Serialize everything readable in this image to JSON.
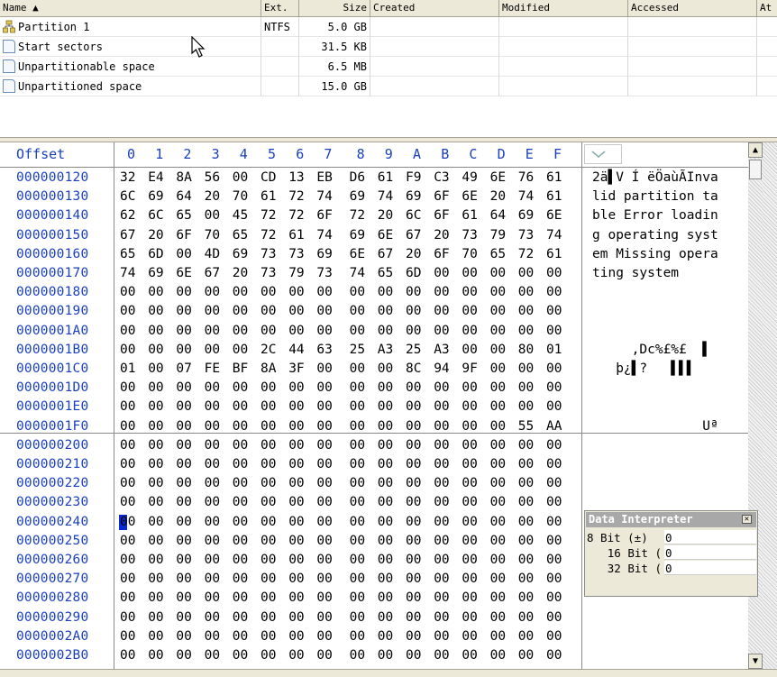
{
  "file_list": {
    "columns": [
      "Name ▲",
      "Ext.",
      "Size",
      "Created",
      "Modified",
      "Accessed",
      "At"
    ],
    "rows": [
      {
        "name": "Partition 1",
        "ext": "NTFS",
        "size": "5.0 GB",
        "icon": "partition-icon"
      },
      {
        "name": "Start sectors",
        "ext": "",
        "size": "31.5 KB",
        "icon": "document-icon"
      },
      {
        "name": "Unpartitionable space",
        "ext": "",
        "size": "6.5 MB",
        "icon": "document-icon"
      },
      {
        "name": "Unpartitioned space",
        "ext": "",
        "size": "15.0 GB",
        "icon": "document-icon"
      }
    ]
  },
  "hex": {
    "offset_header": "Offset",
    "column_headers": [
      "0",
      "1",
      "2",
      "3",
      "4",
      "5",
      "6",
      "7",
      "8",
      "9",
      "A",
      "B",
      "C",
      "D",
      "E",
      "F"
    ],
    "rows": [
      {
        "offset": "000000120",
        "bytes": [
          "32",
          "E4",
          "8A",
          "56",
          "00",
          "CD",
          "13",
          "EB",
          "D6",
          "61",
          "F9",
          "C3",
          "49",
          "6E",
          "76",
          "61"
        ],
        "ascii": "2ä▌V Í ëÖaùÃInva"
      },
      {
        "offset": "000000130",
        "bytes": [
          "6C",
          "69",
          "64",
          "20",
          "70",
          "61",
          "72",
          "74",
          "69",
          "74",
          "69",
          "6F",
          "6E",
          "20",
          "74",
          "61"
        ],
        "ascii": "lid partition ta"
      },
      {
        "offset": "000000140",
        "bytes": [
          "62",
          "6C",
          "65",
          "00",
          "45",
          "72",
          "72",
          "6F",
          "72",
          "20",
          "6C",
          "6F",
          "61",
          "64",
          "69",
          "6E"
        ],
        "ascii": "ble Error loadin"
      },
      {
        "offset": "000000150",
        "bytes": [
          "67",
          "20",
          "6F",
          "70",
          "65",
          "72",
          "61",
          "74",
          "69",
          "6E",
          "67",
          "20",
          "73",
          "79",
          "73",
          "74"
        ],
        "ascii": "g operating syst"
      },
      {
        "offset": "000000160",
        "bytes": [
          "65",
          "6D",
          "00",
          "4D",
          "69",
          "73",
          "73",
          "69",
          "6E",
          "67",
          "20",
          "6F",
          "70",
          "65",
          "72",
          "61"
        ],
        "ascii": "em Missing opera"
      },
      {
        "offset": "000000170",
        "bytes": [
          "74",
          "69",
          "6E",
          "67",
          "20",
          "73",
          "79",
          "73",
          "74",
          "65",
          "6D",
          "00",
          "00",
          "00",
          "00",
          "00"
        ],
        "ascii": "ting system"
      },
      {
        "offset": "000000180",
        "bytes": [
          "00",
          "00",
          "00",
          "00",
          "00",
          "00",
          "00",
          "00",
          "00",
          "00",
          "00",
          "00",
          "00",
          "00",
          "00",
          "00"
        ],
        "ascii": ""
      },
      {
        "offset": "000000190",
        "bytes": [
          "00",
          "00",
          "00",
          "00",
          "00",
          "00",
          "00",
          "00",
          "00",
          "00",
          "00",
          "00",
          "00",
          "00",
          "00",
          "00"
        ],
        "ascii": ""
      },
      {
        "offset": "0000001A0",
        "bytes": [
          "00",
          "00",
          "00",
          "00",
          "00",
          "00",
          "00",
          "00",
          "00",
          "00",
          "00",
          "00",
          "00",
          "00",
          "00",
          "00"
        ],
        "ascii": ""
      },
      {
        "offset": "0000001B0",
        "bytes": [
          "00",
          "00",
          "00",
          "00",
          "00",
          "2C",
          "44",
          "63",
          "25",
          "A3",
          "25",
          "A3",
          "00",
          "00",
          "80",
          "01"
        ],
        "ascii": "     ,Dc%£%£  ▌"
      },
      {
        "offset": "0000001C0",
        "bytes": [
          "01",
          "00",
          "07",
          "FE",
          "BF",
          "8A",
          "3F",
          "00",
          "00",
          "00",
          "8C",
          "94",
          "9F",
          "00",
          "00",
          "00"
        ],
        "ascii": "   þ¿▌?   ▌▌▌"
      },
      {
        "offset": "0000001D0",
        "bytes": [
          "00",
          "00",
          "00",
          "00",
          "00",
          "00",
          "00",
          "00",
          "00",
          "00",
          "00",
          "00",
          "00",
          "00",
          "00",
          "00"
        ],
        "ascii": ""
      },
      {
        "offset": "0000001E0",
        "bytes": [
          "00",
          "00",
          "00",
          "00",
          "00",
          "00",
          "00",
          "00",
          "00",
          "00",
          "00",
          "00",
          "00",
          "00",
          "00",
          "00"
        ],
        "ascii": ""
      },
      {
        "offset": "0000001F0",
        "bytes": [
          "00",
          "00",
          "00",
          "00",
          "00",
          "00",
          "00",
          "00",
          "00",
          "00",
          "00",
          "00",
          "00",
          "00",
          "55",
          "AA"
        ],
        "ascii": "              Uª"
      },
      {
        "offset": "000000200",
        "bytes": [
          "00",
          "00",
          "00",
          "00",
          "00",
          "00",
          "00",
          "00",
          "00",
          "00",
          "00",
          "00",
          "00",
          "00",
          "00",
          "00"
        ],
        "ascii": ""
      },
      {
        "offset": "000000210",
        "bytes": [
          "00",
          "00",
          "00",
          "00",
          "00",
          "00",
          "00",
          "00",
          "00",
          "00",
          "00",
          "00",
          "00",
          "00",
          "00",
          "00"
        ],
        "ascii": ""
      },
      {
        "offset": "000000220",
        "bytes": [
          "00",
          "00",
          "00",
          "00",
          "00",
          "00",
          "00",
          "00",
          "00",
          "00",
          "00",
          "00",
          "00",
          "00",
          "00",
          "00"
        ],
        "ascii": ""
      },
      {
        "offset": "000000230",
        "bytes": [
          "00",
          "00",
          "00",
          "00",
          "00",
          "00",
          "00",
          "00",
          "00",
          "00",
          "00",
          "00",
          "00",
          "00",
          "00",
          "00"
        ],
        "ascii": ""
      },
      {
        "offset": "000000240",
        "bytes": [
          "00",
          "00",
          "00",
          "00",
          "00",
          "00",
          "00",
          "00",
          "00",
          "00",
          "00",
          "00",
          "00",
          "00",
          "00",
          "00"
        ],
        "ascii": ""
      },
      {
        "offset": "000000250",
        "bytes": [
          "00",
          "00",
          "00",
          "00",
          "00",
          "00",
          "00",
          "00",
          "00",
          "00",
          "00",
          "00",
          "00",
          "00",
          "00",
          "00"
        ],
        "ascii": ""
      },
      {
        "offset": "000000260",
        "bytes": [
          "00",
          "00",
          "00",
          "00",
          "00",
          "00",
          "00",
          "00",
          "00",
          "00",
          "00",
          "00",
          "00",
          "00",
          "00",
          "00"
        ],
        "ascii": ""
      },
      {
        "offset": "000000270",
        "bytes": [
          "00",
          "00",
          "00",
          "00",
          "00",
          "00",
          "00",
          "00",
          "00",
          "00",
          "00",
          "00",
          "00",
          "00",
          "00",
          "00"
        ],
        "ascii": ""
      },
      {
        "offset": "000000280",
        "bytes": [
          "00",
          "00",
          "00",
          "00",
          "00",
          "00",
          "00",
          "00",
          "00",
          "00",
          "00",
          "00",
          "00",
          "00",
          "00",
          "00"
        ],
        "ascii": ""
      },
      {
        "offset": "000000290",
        "bytes": [
          "00",
          "00",
          "00",
          "00",
          "00",
          "00",
          "00",
          "00",
          "00",
          "00",
          "00",
          "00",
          "00",
          "00",
          "00",
          "00"
        ],
        "ascii": ""
      },
      {
        "offset": "0000002A0",
        "bytes": [
          "00",
          "00",
          "00",
          "00",
          "00",
          "00",
          "00",
          "00",
          "00",
          "00",
          "00",
          "00",
          "00",
          "00",
          "00",
          "00"
        ],
        "ascii": ""
      },
      {
        "offset": "0000002B0",
        "bytes": [
          "00",
          "00",
          "00",
          "00",
          "00",
          "00",
          "00",
          "00",
          "00",
          "00",
          "00",
          "00",
          "00",
          "00",
          "00",
          "00"
        ],
        "ascii": ""
      }
    ],
    "cursor": {
      "row": 18,
      "col": 0
    },
    "colors": {
      "offset": "#1a3fbf",
      "cursor": "#0a2ad8"
    }
  },
  "data_interpreter": {
    "title": "Data Interpreter",
    "rows": [
      {
        "label": "8 Bit (±)",
        "value": "0"
      },
      {
        "label": "16 Bit (",
        "value": "0"
      },
      {
        "label": "32 Bit (",
        "value": "0"
      }
    ]
  }
}
